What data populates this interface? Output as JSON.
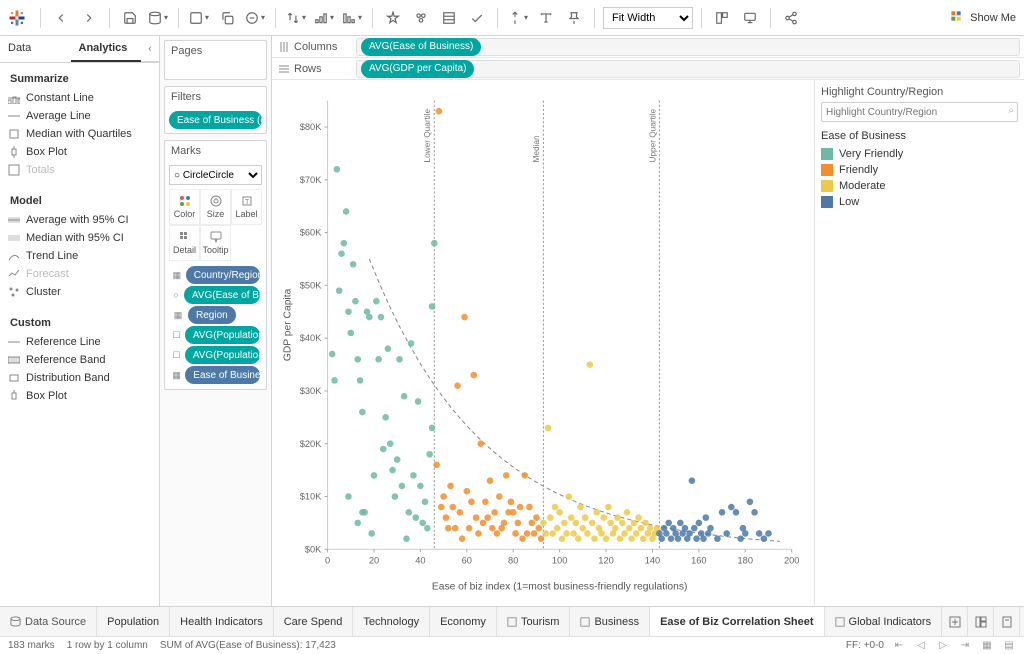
{
  "toolbar": {
    "fit_options": [
      "Fit Width"
    ],
    "showme_label": "Show Me"
  },
  "side_tabs": {
    "data": "Data",
    "analytics": "Analytics"
  },
  "analytics": {
    "summarize_head": "Summarize",
    "summarize_items": [
      "Constant Line",
      "Average Line",
      "Median with Quartiles",
      "Box Plot",
      "Totals"
    ],
    "model_head": "Model",
    "model_items": [
      "Average with 95% CI",
      "Median with 95% CI",
      "Trend Line",
      "Forecast",
      "Cluster"
    ],
    "custom_head": "Custom",
    "custom_items": [
      "Reference Line",
      "Reference Band",
      "Distribution Band",
      "Box Plot"
    ]
  },
  "cards": {
    "pages": "Pages",
    "filters": "Filters",
    "filter_pill": "Ease of Business (cl..",
    "marks": "Marks",
    "mark_type": "Circle",
    "mark_cells": [
      "Color",
      "Size",
      "Label",
      "Detail",
      "Tooltip"
    ],
    "mark_pills": [
      {
        "label": "Country/Region",
        "color": "blue"
      },
      {
        "label": "AVG(Ease of Busi..",
        "color": "teal"
      },
      {
        "label": "Region",
        "color": "blue"
      },
      {
        "label": "AVG(Population..",
        "color": "teal"
      },
      {
        "label": "AVG(Population..",
        "color": "teal"
      },
      {
        "label": "Ease of Busine..",
        "color": "blue"
      }
    ]
  },
  "shelves": {
    "columns_label": "Columns",
    "rows_label": "Rows",
    "columns_pill": "AVG(Ease of Business)",
    "rows_pill": "AVG(GDP per Capita)"
  },
  "right": {
    "highlight_head": "Highlight Country/Region",
    "highlight_placeholder": "Highlight Country/Region",
    "legend_title": "Ease of Business",
    "legend_items": [
      {
        "label": "Very Friendly",
        "color": "#6fb9a4"
      },
      {
        "label": "Friendly",
        "color": "#f28e2b"
      },
      {
        "label": "Moderate",
        "color": "#edc948"
      },
      {
        "label": "Low",
        "color": "#4e79a7"
      }
    ]
  },
  "chart_data": {
    "type": "scatter",
    "title": "",
    "xlabel": "Ease of biz index (1=most business-friendly regulations)",
    "ylabel": "GDP per Capita",
    "xlim": [
      0,
      200
    ],
    "ylim": [
      0,
      85000
    ],
    "xticks": [
      0,
      20,
      40,
      60,
      80,
      100,
      120,
      140,
      160,
      180,
      200
    ],
    "yticks": [
      0,
      10000,
      20000,
      30000,
      40000,
      50000,
      60000,
      70000,
      80000
    ],
    "ytick_labels": [
      "$0K",
      "$10K",
      "$20K",
      "$30K",
      "$40K",
      "$50K",
      "$60K",
      "$70K",
      "$80K"
    ],
    "reference_lines": [
      {
        "x": 46,
        "label": "Lower Quartile"
      },
      {
        "x": 93,
        "label": "Median"
      },
      {
        "x": 143,
        "label": "Upper Quartile"
      }
    ],
    "trend": {
      "x0": 18,
      "y0": 55000,
      "x1": 195,
      "y1": 1500,
      "type": "power"
    },
    "series": [
      {
        "name": "Very Friendly",
        "color": "#6fb9a4",
        "points": [
          [
            2,
            37000
          ],
          [
            3,
            32000
          ],
          [
            4,
            72000
          ],
          [
            5,
            49000
          ],
          [
            6,
            56000
          ],
          [
            7,
            58000
          ],
          [
            8,
            64000
          ],
          [
            9,
            45000
          ],
          [
            9,
            10000
          ],
          [
            10,
            41000
          ],
          [
            11,
            54000
          ],
          [
            12,
            47000
          ],
          [
            13,
            36000
          ],
          [
            13,
            5000
          ],
          [
            14,
            32000
          ],
          [
            15,
            26000
          ],
          [
            15,
            7000
          ],
          [
            16,
            7000
          ],
          [
            17,
            45000
          ],
          [
            18,
            44000
          ],
          [
            19,
            3000
          ],
          [
            20,
            14000
          ],
          [
            21,
            47000
          ],
          [
            22,
            36000
          ],
          [
            23,
            44000
          ],
          [
            24,
            19000
          ],
          [
            25,
            25000
          ],
          [
            26,
            38000
          ],
          [
            27,
            20000
          ],
          [
            28,
            15000
          ],
          [
            29,
            10000
          ],
          [
            30,
            17000
          ],
          [
            31,
            36000
          ],
          [
            32,
            12000
          ],
          [
            33,
            29000
          ],
          [
            34,
            2000
          ],
          [
            35,
            7000
          ],
          [
            36,
            39000
          ],
          [
            37,
            14000
          ],
          [
            38,
            6000
          ],
          [
            39,
            28000
          ],
          [
            40,
            12000
          ],
          [
            41,
            5000
          ],
          [
            42,
            9000
          ],
          [
            43,
            4000
          ],
          [
            44,
            18000
          ],
          [
            45,
            23000
          ],
          [
            45,
            46000
          ],
          [
            46,
            58000
          ]
        ]
      },
      {
        "name": "Friendly",
        "color": "#f28e2b",
        "points": [
          [
            47,
            16000
          ],
          [
            48,
            83000
          ],
          [
            49,
            8000
          ],
          [
            50,
            10000
          ],
          [
            51,
            6000
          ],
          [
            52,
            4000
          ],
          [
            53,
            12000
          ],
          [
            54,
            8000
          ],
          [
            55,
            4000
          ],
          [
            56,
            31000
          ],
          [
            57,
            7000
          ],
          [
            58,
            2000
          ],
          [
            59,
            44000
          ],
          [
            60,
            11000
          ],
          [
            61,
            4000
          ],
          [
            62,
            9000
          ],
          [
            63,
            33000
          ],
          [
            64,
            6000
          ],
          [
            65,
            3000
          ],
          [
            66,
            20000
          ],
          [
            67,
            5000
          ],
          [
            68,
            9000
          ],
          [
            69,
            6000
          ],
          [
            70,
            13000
          ],
          [
            71,
            4000
          ],
          [
            72,
            7000
          ],
          [
            73,
            3000
          ],
          [
            74,
            10000
          ],
          [
            75,
            4000
          ],
          [
            76,
            5000
          ],
          [
            77,
            14000
          ],
          [
            78,
            7000
          ],
          [
            79,
            9000
          ],
          [
            80,
            7000
          ],
          [
            81,
            3000
          ],
          [
            82,
            5000
          ],
          [
            83,
            8000
          ],
          [
            84,
            2000
          ],
          [
            85,
            14000
          ],
          [
            86,
            3000
          ],
          [
            87,
            8000
          ],
          [
            88,
            5000
          ],
          [
            89,
            3000
          ],
          [
            90,
            6000
          ],
          [
            91,
            4000
          ],
          [
            92,
            2000
          ]
        ]
      },
      {
        "name": "Moderate",
        "color": "#edc948",
        "points": [
          [
            93,
            5000
          ],
          [
            94,
            3000
          ],
          [
            95,
            23000
          ],
          [
            96,
            6000
          ],
          [
            97,
            3000
          ],
          [
            98,
            8000
          ],
          [
            99,
            4000
          ],
          [
            100,
            7000
          ],
          [
            101,
            2000
          ],
          [
            102,
            5000
          ],
          [
            103,
            3000
          ],
          [
            104,
            10000
          ],
          [
            105,
            6000
          ],
          [
            106,
            3000
          ],
          [
            107,
            5000
          ],
          [
            108,
            2000
          ],
          [
            109,
            8000
          ],
          [
            110,
            4000
          ],
          [
            111,
            6000
          ],
          [
            112,
            3000
          ],
          [
            113,
            35000
          ],
          [
            114,
            5000
          ],
          [
            115,
            2000
          ],
          [
            116,
            7000
          ],
          [
            117,
            4000
          ],
          [
            118,
            3000
          ],
          [
            119,
            6000
          ],
          [
            120,
            2000
          ],
          [
            121,
            8000
          ],
          [
            122,
            5000
          ],
          [
            123,
            3000
          ],
          [
            124,
            4000
          ],
          [
            125,
            6000
          ],
          [
            126,
            2000
          ],
          [
            127,
            5000
          ],
          [
            128,
            3000
          ],
          [
            129,
            7000
          ],
          [
            130,
            4000
          ],
          [
            131,
            2000
          ],
          [
            132,
            5000
          ],
          [
            133,
            3000
          ],
          [
            134,
            6000
          ],
          [
            135,
            4000
          ],
          [
            136,
            2000
          ],
          [
            137,
            5000
          ],
          [
            138,
            3000
          ],
          [
            139,
            4000
          ],
          [
            140,
            2000
          ],
          [
            141,
            3000
          ],
          [
            142,
            4000
          ]
        ]
      },
      {
        "name": "Low",
        "color": "#4e79a7",
        "points": [
          [
            143,
            3000
          ],
          [
            144,
            2000
          ],
          [
            145,
            4000
          ],
          [
            146,
            3000
          ],
          [
            147,
            5000
          ],
          [
            148,
            2000
          ],
          [
            149,
            4000
          ],
          [
            150,
            3000
          ],
          [
            151,
            2000
          ],
          [
            152,
            5000
          ],
          [
            153,
            3000
          ],
          [
            154,
            4000
          ],
          [
            155,
            2000
          ],
          [
            156,
            3000
          ],
          [
            157,
            13000
          ],
          [
            158,
            4000
          ],
          [
            159,
            2000
          ],
          [
            160,
            5000
          ],
          [
            161,
            3000
          ],
          [
            162,
            2000
          ],
          [
            163,
            6000
          ],
          [
            164,
            3000
          ],
          [
            165,
            4000
          ],
          [
            168,
            2000
          ],
          [
            170,
            7000
          ],
          [
            172,
            3000
          ],
          [
            174,
            8000
          ],
          [
            176,
            7000
          ],
          [
            178,
            2000
          ],
          [
            179,
            4000
          ],
          [
            180,
            3000
          ],
          [
            182,
            9000
          ],
          [
            184,
            7000
          ],
          [
            186,
            3000
          ],
          [
            188,
            2000
          ],
          [
            190,
            3000
          ]
        ]
      }
    ]
  },
  "sheets": {
    "data_source": "Data Source",
    "tabs": [
      "Population",
      "Health Indicators",
      "Care Spend",
      "Technology",
      "Economy",
      "Tourism",
      "Business",
      "Ease of Biz Correlation Sheet",
      "Global Indicators"
    ],
    "active_index": 7
  },
  "status": {
    "marks": "183 marks",
    "rows_cols": "1 row by 1 column",
    "sum": "SUM of AVG(Ease of Business): 17,423",
    "fit": "FF: +0-0"
  }
}
